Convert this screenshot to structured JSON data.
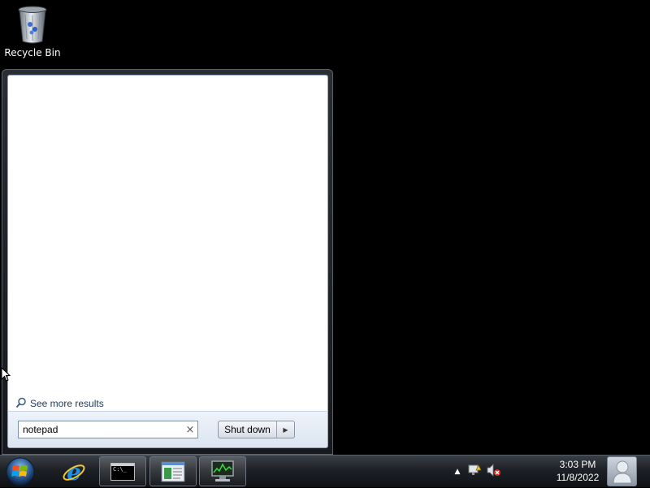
{
  "desktop": {
    "icons": [
      {
        "label": "Recycle Bin",
        "icon": "recycle-bin-icon"
      }
    ]
  },
  "start_menu": {
    "see_more_label": "See more results",
    "search": {
      "value": "notepad",
      "clear_icon": "clear-icon"
    },
    "shutdown_label": "Shut down"
  },
  "taskbar": {
    "buttons": [
      {
        "name": "internet-explorer",
        "icon": "internet-explorer-icon"
      },
      {
        "name": "command-prompt",
        "icon": "command-prompt-icon",
        "label": "C:\\_"
      },
      {
        "name": "document-viewer",
        "icon": "document-icon"
      },
      {
        "name": "task-manager",
        "icon": "task-manager-icon"
      }
    ],
    "tray": [
      "show-hidden-icons",
      "network-icon",
      "volume-muted-icon"
    ],
    "clock": {
      "time": "3:03 PM",
      "date": "11/8/2022"
    }
  },
  "colors": {
    "desktop_bg": "#000000",
    "menu_frame": "#1d2126",
    "results_bg": "#ffffff",
    "link_text": "#1e395b"
  }
}
